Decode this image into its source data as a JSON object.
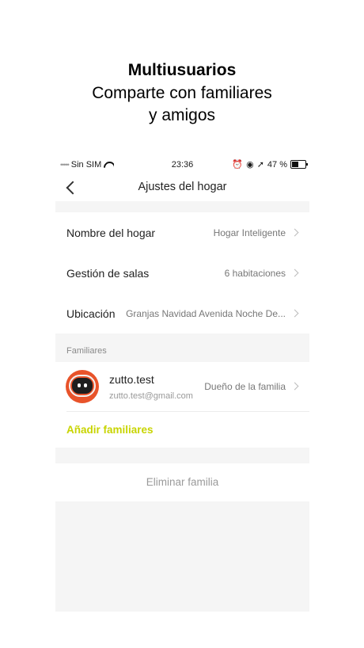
{
  "headline": {
    "title": "Multiusuarios",
    "line1": "Comparte con familiares",
    "line2": "y amigos"
  },
  "statusbar": {
    "carrier": "Sin SIM",
    "time": "23:36",
    "battery_text": "47 %",
    "battery_level": 0.47
  },
  "navbar": {
    "title": "Ajustes del hogar",
    "back_icon": "chevron-left-icon"
  },
  "settings": [
    {
      "label": "Nombre del hogar",
      "value": "Hogar Inteligente"
    },
    {
      "label": "Gestión de salas",
      "value": "6 habitaciones"
    },
    {
      "label": "Ubicación",
      "value": "Granjas Navidad Avenida Noche De..."
    }
  ],
  "members": {
    "header": "Familiares",
    "list": [
      {
        "name": "zutto.test",
        "email": "zutto.test@gmail.com",
        "role": "Dueño de la familia"
      }
    ],
    "add_label": "Añadir familiares"
  },
  "delete_label": "Eliminar familia",
  "colors": {
    "accent": "#c8d400",
    "avatar": "#e8532a",
    "background": "#f5f5f5"
  }
}
